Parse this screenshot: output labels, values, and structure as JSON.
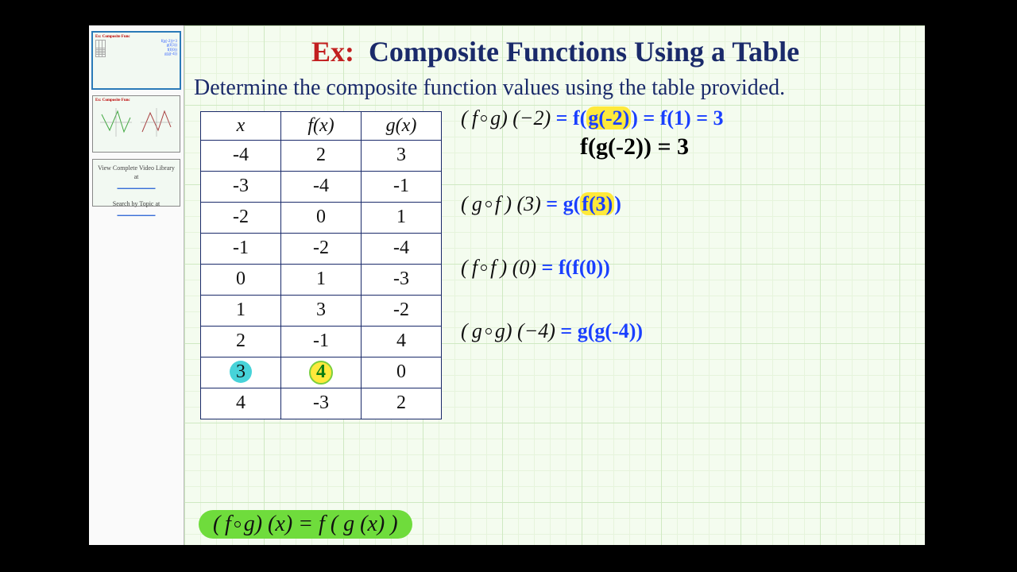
{
  "title": {
    "ex": "Ex:",
    "main": "Composite Functions Using a Table"
  },
  "instruction": "Determine the composite function values using the table provided.",
  "table": {
    "headers": [
      "x",
      "f(x)",
      "g(x)"
    ],
    "rows": [
      {
        "x": "-4",
        "fx": "2",
        "gx": "3"
      },
      {
        "x": "-3",
        "fx": "-4",
        "gx": "-1"
      },
      {
        "x": "-2",
        "fx": "0",
        "gx": "1"
      },
      {
        "x": "-1",
        "fx": "-2",
        "gx": "-4"
      },
      {
        "x": "0",
        "fx": "1",
        "gx": "-3"
      },
      {
        "x": "1",
        "fx": "3",
        "gx": "-2"
      },
      {
        "x": "2",
        "fx": "-1",
        "gx": "4"
      },
      {
        "x": "3",
        "fx": "4",
        "gx": "0"
      },
      {
        "x": "4",
        "fx": "-3",
        "gx": "2"
      }
    ],
    "highlight": {
      "row": 7,
      "x_color": "teal",
      "fx_color": "yellow"
    }
  },
  "equations": {
    "line1": {
      "typed": "( f ∘ g ) (−2)",
      "hand_a": "= f(",
      "hand_hl": "g(-2)",
      "hand_b": ") = f(1) = 3",
      "sub": "f(g(-2)) = 3"
    },
    "line2": {
      "typed": "( g ∘ f ) (3)",
      "hand_a": "= g(",
      "hand_hl": "f(3)",
      "hand_b": ")"
    },
    "line3": {
      "typed": "( f ∘ f ) (0)",
      "hand": "= f(f(0))"
    },
    "line4": {
      "typed": "( g ∘ g ) (−4)",
      "hand": "= g(g(-4))"
    }
  },
  "formula": "( f ∘ g ) (x) = f ( g (x) )",
  "sidebar": {
    "thumb_title": "Ex: Composite Func",
    "lib1": "View Complete Video Library at",
    "lib2": "Search by Topic at"
  }
}
